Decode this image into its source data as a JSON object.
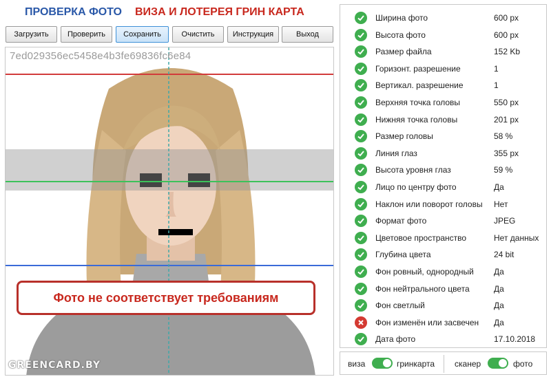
{
  "header": {
    "title_photo": "ПРОВЕРКА ФОТО",
    "title_visa": "ВИЗА И ЛОТЕРЕЯ ГРИН КАРТА"
  },
  "toolbar": {
    "buttons": [
      {
        "label": "Загрузить"
      },
      {
        "label": "Проверить"
      },
      {
        "label": "Сохранить"
      },
      {
        "label": "Очистить"
      },
      {
        "label": "Инструкция"
      },
      {
        "label": "Выход"
      }
    ],
    "active_index": 2
  },
  "photo": {
    "hash": "7ed029356ec5458e4b3fe69836fc6e84",
    "warning": "Фото не соответствует требованиям",
    "watermark": "GREENCARD.BY",
    "guide_colors": {
      "top": "#d23a3a",
      "eyes": "#3cc25a",
      "chin": "#3a6bd8",
      "center": "#3fa8a8"
    }
  },
  "results": {
    "rows": [
      {
        "label": "Ширина фото",
        "value": "600 px",
        "status": "ok"
      },
      {
        "label": "Высота фото",
        "value": "600 px",
        "status": "ok"
      },
      {
        "label": "Размер файла",
        "value": "152 Kb",
        "status": "ok"
      },
      {
        "label": "Горизонт. разрешение",
        "value": "1",
        "status": "ok"
      },
      {
        "label": "Вертикал. разрешение",
        "value": "1",
        "status": "ok"
      },
      {
        "label": "Верхняя точка головы",
        "value": "550 px",
        "status": "ok"
      },
      {
        "label": "Нижняя точка головы",
        "value": "201 px",
        "status": "ok"
      },
      {
        "label": "Размер головы",
        "value": "58 %",
        "status": "ok"
      },
      {
        "label": "Линия глаз",
        "value": "355 px",
        "status": "ok"
      },
      {
        "label": "Высота уровня глаз",
        "value": "59 %",
        "status": "ok"
      },
      {
        "label": "Лицо по центру фото",
        "value": "Да",
        "status": "ok"
      },
      {
        "label": "Наклон или поворот головы",
        "value": "Нет",
        "status": "ok"
      },
      {
        "label": "Формат фото",
        "value": "JPEG",
        "status": "ok"
      },
      {
        "label": "Цветовое пространство",
        "value": "Нет данных",
        "status": "ok"
      },
      {
        "label": "Глубина цвета",
        "value": "24 bit",
        "status": "ok"
      },
      {
        "label": "Фон ровный, однородный",
        "value": "Да",
        "status": "ok"
      },
      {
        "label": "Фон нейтрального цвета",
        "value": "Да",
        "status": "ok"
      },
      {
        "label": "Фон светлый",
        "value": "Да",
        "status": "ok"
      },
      {
        "label": "Фон изменён или засвечен",
        "value": "Да",
        "status": "fail"
      },
      {
        "label": "Дата фото",
        "value": "17.10.2018",
        "status": "ok"
      }
    ],
    "status_colors": {
      "ok": "#3fae4f",
      "fail": "#d43a32"
    }
  },
  "toggles": {
    "left_off": "виза",
    "left_on": "гринкарта",
    "right_off": "сканер",
    "right_on": "фото"
  }
}
